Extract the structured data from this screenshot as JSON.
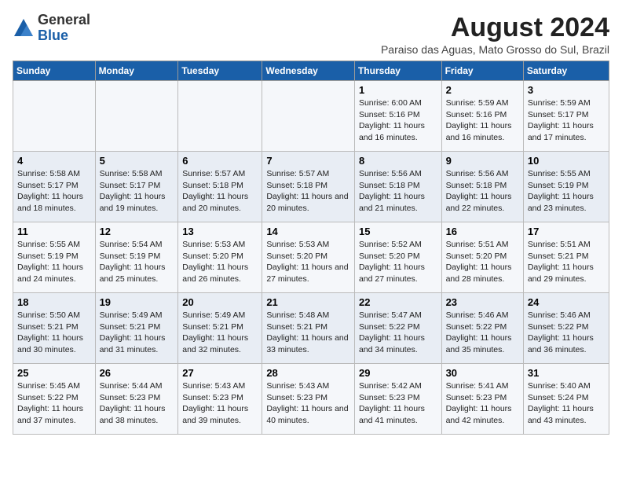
{
  "header": {
    "logo_general": "General",
    "logo_blue": "Blue",
    "month_year": "August 2024",
    "location": "Paraiso das Aguas, Mato Grosso do Sul, Brazil"
  },
  "days_of_week": [
    "Sunday",
    "Monday",
    "Tuesday",
    "Wednesday",
    "Thursday",
    "Friday",
    "Saturday"
  ],
  "weeks": [
    [
      {
        "day": "",
        "info": ""
      },
      {
        "day": "",
        "info": ""
      },
      {
        "day": "",
        "info": ""
      },
      {
        "day": "",
        "info": ""
      },
      {
        "day": "1",
        "info": "Sunrise: 6:00 AM\nSunset: 5:16 PM\nDaylight: 11 hours and 16 minutes."
      },
      {
        "day": "2",
        "info": "Sunrise: 5:59 AM\nSunset: 5:16 PM\nDaylight: 11 hours and 16 minutes."
      },
      {
        "day": "3",
        "info": "Sunrise: 5:59 AM\nSunset: 5:17 PM\nDaylight: 11 hours and 17 minutes."
      }
    ],
    [
      {
        "day": "4",
        "info": "Sunrise: 5:58 AM\nSunset: 5:17 PM\nDaylight: 11 hours and 18 minutes."
      },
      {
        "day": "5",
        "info": "Sunrise: 5:58 AM\nSunset: 5:17 PM\nDaylight: 11 hours and 19 minutes."
      },
      {
        "day": "6",
        "info": "Sunrise: 5:57 AM\nSunset: 5:18 PM\nDaylight: 11 hours and 20 minutes."
      },
      {
        "day": "7",
        "info": "Sunrise: 5:57 AM\nSunset: 5:18 PM\nDaylight: 11 hours and 20 minutes."
      },
      {
        "day": "8",
        "info": "Sunrise: 5:56 AM\nSunset: 5:18 PM\nDaylight: 11 hours and 21 minutes."
      },
      {
        "day": "9",
        "info": "Sunrise: 5:56 AM\nSunset: 5:18 PM\nDaylight: 11 hours and 22 minutes."
      },
      {
        "day": "10",
        "info": "Sunrise: 5:55 AM\nSunset: 5:19 PM\nDaylight: 11 hours and 23 minutes."
      }
    ],
    [
      {
        "day": "11",
        "info": "Sunrise: 5:55 AM\nSunset: 5:19 PM\nDaylight: 11 hours and 24 minutes."
      },
      {
        "day": "12",
        "info": "Sunrise: 5:54 AM\nSunset: 5:19 PM\nDaylight: 11 hours and 25 minutes."
      },
      {
        "day": "13",
        "info": "Sunrise: 5:53 AM\nSunset: 5:20 PM\nDaylight: 11 hours and 26 minutes."
      },
      {
        "day": "14",
        "info": "Sunrise: 5:53 AM\nSunset: 5:20 PM\nDaylight: 11 hours and 27 minutes."
      },
      {
        "day": "15",
        "info": "Sunrise: 5:52 AM\nSunset: 5:20 PM\nDaylight: 11 hours and 27 minutes."
      },
      {
        "day": "16",
        "info": "Sunrise: 5:51 AM\nSunset: 5:20 PM\nDaylight: 11 hours and 28 minutes."
      },
      {
        "day": "17",
        "info": "Sunrise: 5:51 AM\nSunset: 5:21 PM\nDaylight: 11 hours and 29 minutes."
      }
    ],
    [
      {
        "day": "18",
        "info": "Sunrise: 5:50 AM\nSunset: 5:21 PM\nDaylight: 11 hours and 30 minutes."
      },
      {
        "day": "19",
        "info": "Sunrise: 5:49 AM\nSunset: 5:21 PM\nDaylight: 11 hours and 31 minutes."
      },
      {
        "day": "20",
        "info": "Sunrise: 5:49 AM\nSunset: 5:21 PM\nDaylight: 11 hours and 32 minutes."
      },
      {
        "day": "21",
        "info": "Sunrise: 5:48 AM\nSunset: 5:21 PM\nDaylight: 11 hours and 33 minutes."
      },
      {
        "day": "22",
        "info": "Sunrise: 5:47 AM\nSunset: 5:22 PM\nDaylight: 11 hours and 34 minutes."
      },
      {
        "day": "23",
        "info": "Sunrise: 5:46 AM\nSunset: 5:22 PM\nDaylight: 11 hours and 35 minutes."
      },
      {
        "day": "24",
        "info": "Sunrise: 5:46 AM\nSunset: 5:22 PM\nDaylight: 11 hours and 36 minutes."
      }
    ],
    [
      {
        "day": "25",
        "info": "Sunrise: 5:45 AM\nSunset: 5:22 PM\nDaylight: 11 hours and 37 minutes."
      },
      {
        "day": "26",
        "info": "Sunrise: 5:44 AM\nSunset: 5:23 PM\nDaylight: 11 hours and 38 minutes."
      },
      {
        "day": "27",
        "info": "Sunrise: 5:43 AM\nSunset: 5:23 PM\nDaylight: 11 hours and 39 minutes."
      },
      {
        "day": "28",
        "info": "Sunrise: 5:43 AM\nSunset: 5:23 PM\nDaylight: 11 hours and 40 minutes."
      },
      {
        "day": "29",
        "info": "Sunrise: 5:42 AM\nSunset: 5:23 PM\nDaylight: 11 hours and 41 minutes."
      },
      {
        "day": "30",
        "info": "Sunrise: 5:41 AM\nSunset: 5:23 PM\nDaylight: 11 hours and 42 minutes."
      },
      {
        "day": "31",
        "info": "Sunrise: 5:40 AM\nSunset: 5:24 PM\nDaylight: 11 hours and 43 minutes."
      }
    ]
  ]
}
